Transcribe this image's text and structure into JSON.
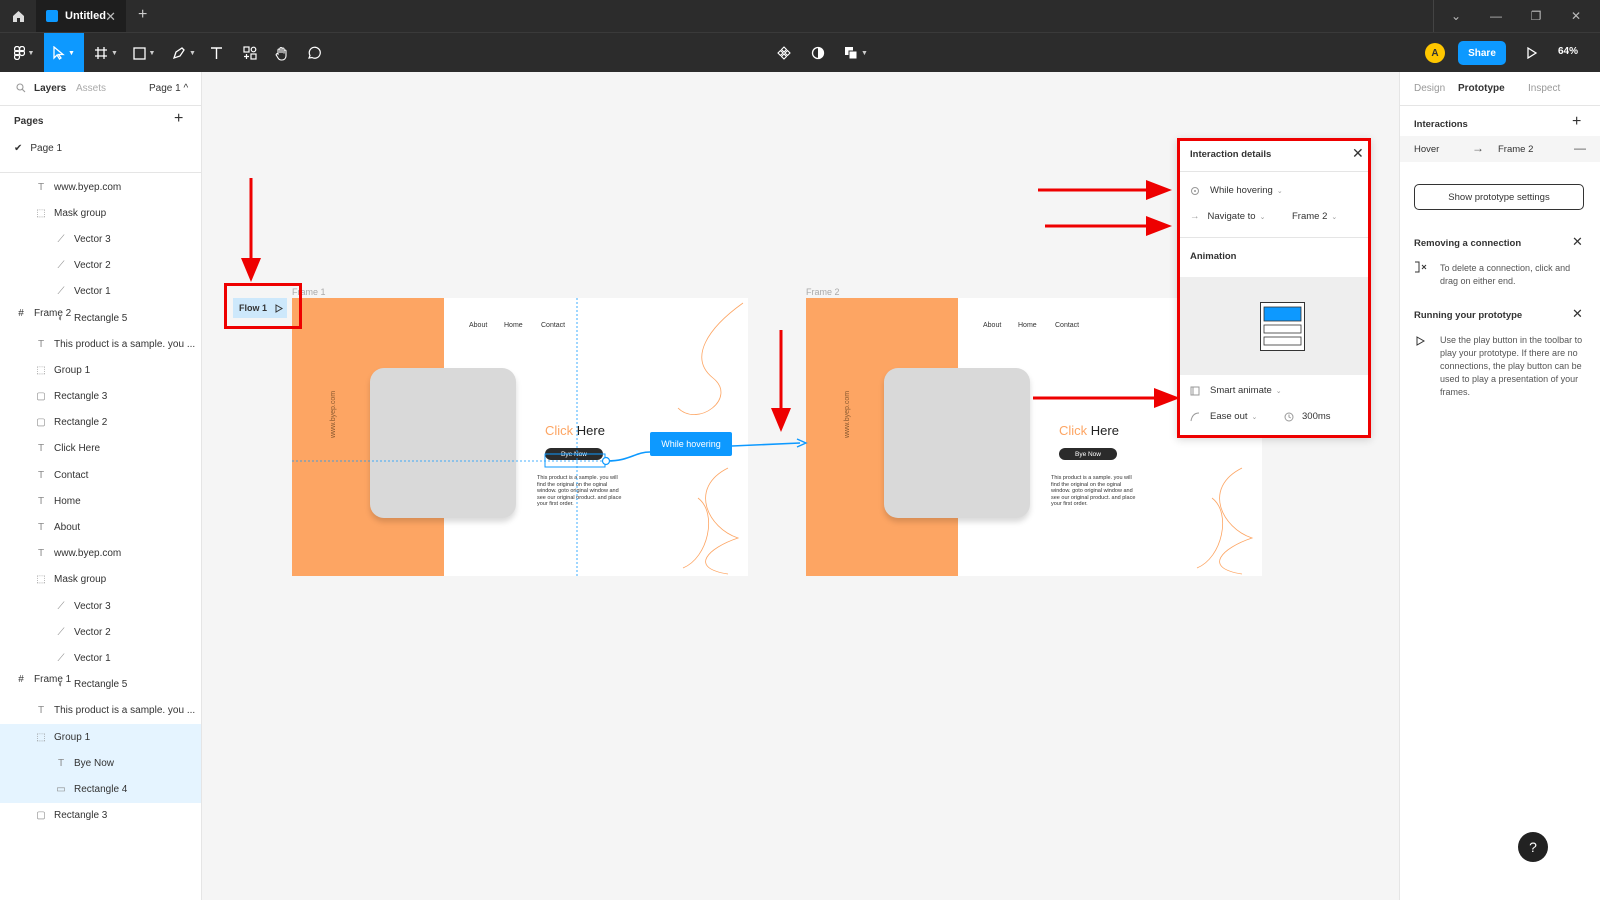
{
  "titlebar": {
    "tab_title": "Untitled",
    "tab_close": "✕",
    "new_tab": "+"
  },
  "toolbar": {
    "share_label": "Share",
    "zoom": "64%",
    "avatar_initial": "A"
  },
  "left_panel": {
    "tabs": {
      "layers": "Layers",
      "assets": "Assets",
      "page_selector": "Page 1 ^"
    },
    "pages_title": "Pages",
    "pages": [
      "Page 1"
    ],
    "layers": [
      {
        "label": "Frame 2",
        "icon": "frame-icon",
        "indent": 0,
        "selected": false
      },
      {
        "label": "www.byep.com",
        "icon": "text-icon",
        "indent": 1,
        "selected": false
      },
      {
        "label": "Mask group",
        "icon": "mask-icon",
        "indent": 1,
        "selected": false
      },
      {
        "label": "Vector 3",
        "icon": "vector-icon",
        "indent": 2,
        "selected": false
      },
      {
        "label": "Vector 2",
        "icon": "vector-icon",
        "indent": 2,
        "selected": false
      },
      {
        "label": "Vector 1",
        "icon": "vector-icon",
        "indent": 2,
        "selected": false
      },
      {
        "label": "Rectangle 5",
        "icon": "mask-shape-icon",
        "indent": 2,
        "selected": false
      },
      {
        "label": "This product is a sample. you ...",
        "icon": "text-icon",
        "indent": 1,
        "selected": false
      },
      {
        "label": "Group 1",
        "icon": "group-icon",
        "indent": 1,
        "selected": false
      },
      {
        "label": "Rectangle 3",
        "icon": "rectangle-icon",
        "indent": 1,
        "selected": false
      },
      {
        "label": "Rectangle 2",
        "icon": "rectangle-icon",
        "indent": 1,
        "selected": false
      },
      {
        "label": "Click Here",
        "icon": "text-icon",
        "indent": 1,
        "selected": false
      },
      {
        "label": "Contact",
        "icon": "text-icon",
        "indent": 1,
        "selected": false
      },
      {
        "label": "Home",
        "icon": "text-icon",
        "indent": 1,
        "selected": false
      },
      {
        "label": "About",
        "icon": "text-icon",
        "indent": 1,
        "selected": false
      },
      {
        "label": "Frame 1",
        "icon": "frame-icon",
        "indent": 0,
        "selected": false
      },
      {
        "label": "www.byep.com",
        "icon": "text-icon",
        "indent": 1,
        "selected": false
      },
      {
        "label": "Mask group",
        "icon": "mask-icon",
        "indent": 1,
        "selected": false
      },
      {
        "label": "Vector 3",
        "icon": "vector-icon",
        "indent": 2,
        "selected": false
      },
      {
        "label": "Vector 2",
        "icon": "vector-icon",
        "indent": 2,
        "selected": false
      },
      {
        "label": "Vector 1",
        "icon": "vector-icon",
        "indent": 2,
        "selected": false
      },
      {
        "label": "Rectangle 5",
        "icon": "mask-shape-icon",
        "indent": 2,
        "selected": false
      },
      {
        "label": "This product is a sample. you ...",
        "icon": "text-icon",
        "indent": 1,
        "selected": false
      },
      {
        "label": "Group 1",
        "icon": "group-icon",
        "indent": 1,
        "selected": true
      },
      {
        "label": "Bye Now",
        "icon": "text-icon",
        "indent": 2,
        "selected": true
      },
      {
        "label": "Rectangle 4",
        "icon": "line-icon",
        "indent": 2,
        "selected": true
      },
      {
        "label": "Rectangle 3",
        "icon": "rectangle-icon",
        "indent": 1,
        "selected": false
      }
    ]
  },
  "canvas": {
    "frame1_label": "Frame 1",
    "frame2_label": "Frame 2",
    "flow_badge": "Flow 1",
    "hover_pill": "While hovering",
    "site_url": "www.byep.com",
    "nav": {
      "about": "About",
      "home": "Home",
      "contact": "Contact"
    },
    "headline_click": "Click",
    "headline_here": "Here",
    "bye_button": "Bye Now",
    "paragraph": "This product is a sample. you will find the original on the oginal window. goto original window and see our original product. and place your first order.",
    "accent_orange": "#fda563",
    "accent_blue": "#0d99ff"
  },
  "popover": {
    "title": "Interaction details",
    "trigger": "While hovering",
    "action": "Navigate to",
    "destination": "Frame 2",
    "animation_title": "Animation",
    "animation_type": "Smart animate",
    "easing": "Ease out",
    "duration": "300ms"
  },
  "right_panel": {
    "tabs": {
      "design": "Design",
      "prototype": "Prototype",
      "inspect": "Inspect"
    },
    "interactions_title": "Interactions",
    "interaction": {
      "trigger": "Hover",
      "target": "Frame 2"
    },
    "show_settings_button": "Show prototype settings",
    "removing_title": "Removing a connection",
    "removing_text": "To delete a connection, click and drag on either end.",
    "running_title": "Running your prototype",
    "running_text": "Use the play button in the toolbar to play your prototype. If there are no connections, the play button can be used to play a presentation of your frames.",
    "help": "?"
  }
}
